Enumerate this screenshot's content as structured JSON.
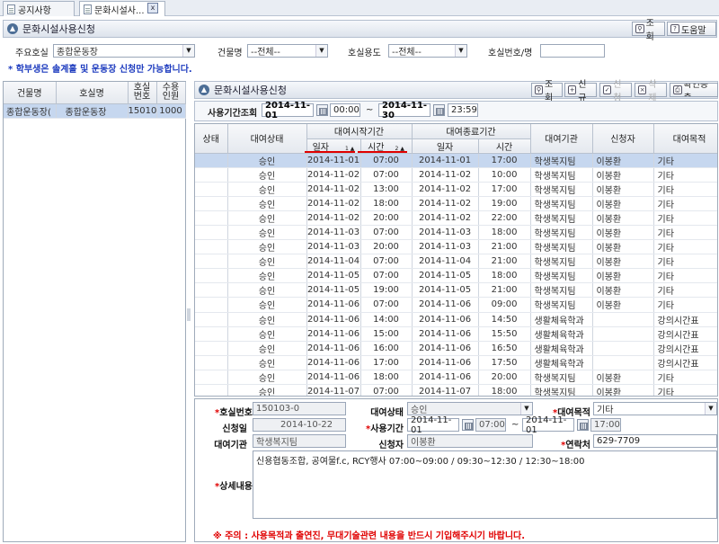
{
  "tabs": [
    {
      "label": "공지사항",
      "active": false
    },
    {
      "label": "문화시설사...",
      "active": true
    }
  ],
  "top_panel": {
    "title": "문화시설사용신청",
    "buttons": {
      "search": "조회",
      "help": "도움말"
    }
  },
  "filters": {
    "main_facility_label": "주요호실",
    "main_facility_value": "종합운동장",
    "building_label": "건물명",
    "building_value": "--전체--",
    "usage_label": "호실용도",
    "usage_value": "--전체--",
    "room_no_label": "호실번호/명",
    "room_no_value": ""
  },
  "notice": "* 학부생은 솔계홀 및 운동장 신청만 가능합니다.",
  "left_grid": {
    "headers": {
      "building": "건물명",
      "room": "호실명",
      "room_no_1": "호실",
      "room_no_2": "번호",
      "capacity_1": "수용",
      "capacity_2": "인원"
    },
    "rows": [
      {
        "building": "종합운동장(",
        "room": "종합운동장",
        "room_no": "150103",
        "capacity": "1000"
      }
    ]
  },
  "right_panel": {
    "title": "문화시설사용신청",
    "buttons": {
      "search": "조회",
      "new": "신규",
      "apply": "신청",
      "delete": "삭제",
      "print": "확인증출"
    }
  },
  "period": {
    "label": "사용기간조회",
    "from_date": "2014-11-01",
    "from_time": "00:00",
    "sep": "~",
    "to_date": "2014-11-30",
    "to_time": "23:59"
  },
  "grid": {
    "headers": {
      "status": "상태",
      "rent_status": "대여상태",
      "start_group": "대여시작기간",
      "start_date": "일자",
      "start_date_sort": "1",
      "start_time": "시간",
      "start_time_sort": "2",
      "end_group": "대여종료기간",
      "end_date": "일자",
      "end_time": "시간",
      "agency": "대여기관",
      "applicant": "신청자",
      "purpose": "대여목적"
    },
    "rows": [
      {
        "rent_status": "승인",
        "start_date": "2014-11-01",
        "start_time": "07:00",
        "end_date": "2014-11-01",
        "end_time": "17:00",
        "agency": "학생복지팀",
        "applicant": "이봉환",
        "purpose": "기타"
      },
      {
        "rent_status": "승인",
        "start_date": "2014-11-02",
        "start_time": "07:00",
        "end_date": "2014-11-02",
        "end_time": "10:00",
        "agency": "학생복지팀",
        "applicant": "이봉환",
        "purpose": "기타"
      },
      {
        "rent_status": "승인",
        "start_date": "2014-11-02",
        "start_time": "13:00",
        "end_date": "2014-11-02",
        "end_time": "17:00",
        "agency": "학생복지팀",
        "applicant": "이봉환",
        "purpose": "기타"
      },
      {
        "rent_status": "승인",
        "start_date": "2014-11-02",
        "start_time": "18:00",
        "end_date": "2014-11-02",
        "end_time": "19:00",
        "agency": "학생복지팀",
        "applicant": "이봉환",
        "purpose": "기타"
      },
      {
        "rent_status": "승인",
        "start_date": "2014-11-02",
        "start_time": "20:00",
        "end_date": "2014-11-02",
        "end_time": "22:00",
        "agency": "학생복지팀",
        "applicant": "이봉환",
        "purpose": "기타"
      },
      {
        "rent_status": "승인",
        "start_date": "2014-11-03",
        "start_time": "07:00",
        "end_date": "2014-11-03",
        "end_time": "18:00",
        "agency": "학생복지팀",
        "applicant": "이봉환",
        "purpose": "기타"
      },
      {
        "rent_status": "승인",
        "start_date": "2014-11-03",
        "start_time": "20:00",
        "end_date": "2014-11-03",
        "end_time": "21:00",
        "agency": "학생복지팀",
        "applicant": "이봉환",
        "purpose": "기타"
      },
      {
        "rent_status": "승인",
        "start_date": "2014-11-04",
        "start_time": "07:00",
        "end_date": "2014-11-04",
        "end_time": "21:00",
        "agency": "학생복지팀",
        "applicant": "이봉환",
        "purpose": "기타"
      },
      {
        "rent_status": "승인",
        "start_date": "2014-11-05",
        "start_time": "07:00",
        "end_date": "2014-11-05",
        "end_time": "18:00",
        "agency": "학생복지팀",
        "applicant": "이봉환",
        "purpose": "기타"
      },
      {
        "rent_status": "승인",
        "start_date": "2014-11-05",
        "start_time": "19:00",
        "end_date": "2014-11-05",
        "end_time": "21:00",
        "agency": "학생복지팀",
        "applicant": "이봉환",
        "purpose": "기타"
      },
      {
        "rent_status": "승인",
        "start_date": "2014-11-06",
        "start_time": "07:00",
        "end_date": "2014-11-06",
        "end_time": "09:00",
        "agency": "학생복지팀",
        "applicant": "이봉환",
        "purpose": "기타"
      },
      {
        "rent_status": "승인",
        "start_date": "2014-11-06",
        "start_time": "14:00",
        "end_date": "2014-11-06",
        "end_time": "14:50",
        "agency": "생활체육학과",
        "applicant": "",
        "purpose": "강의시간표"
      },
      {
        "rent_status": "승인",
        "start_date": "2014-11-06",
        "start_time": "15:00",
        "end_date": "2014-11-06",
        "end_time": "15:50",
        "agency": "생활체육학과",
        "applicant": "",
        "purpose": "강의시간표"
      },
      {
        "rent_status": "승인",
        "start_date": "2014-11-06",
        "start_time": "16:00",
        "end_date": "2014-11-06",
        "end_time": "16:50",
        "agency": "생활체육학과",
        "applicant": "",
        "purpose": "강의시간표"
      },
      {
        "rent_status": "승인",
        "start_date": "2014-11-06",
        "start_time": "17:00",
        "end_date": "2014-11-06",
        "end_time": "17:50",
        "agency": "생활체육학과",
        "applicant": "",
        "purpose": "강의시간표"
      },
      {
        "rent_status": "승인",
        "start_date": "2014-11-06",
        "start_time": "18:00",
        "end_date": "2014-11-06",
        "end_time": "20:00",
        "agency": "학생복지팀",
        "applicant": "이봉환",
        "purpose": "기타"
      },
      {
        "rent_status": "승인",
        "start_date": "2014-11-07",
        "start_time": "07:00",
        "end_date": "2014-11-07",
        "end_time": "18:00",
        "agency": "학생복지팀",
        "applicant": "이봉환",
        "purpose": "기타"
      }
    ]
  },
  "detail": {
    "room_no_label": "호실번호",
    "room_no_value": "150103-0",
    "rent_status_label": "대여상태",
    "rent_status_value": "승인",
    "purpose_label": "대여목적",
    "purpose_value": "기타",
    "apply_date_label": "신청일",
    "apply_date_value": "2014-10-22",
    "period_label": "사용기간",
    "period_from_date": "2014-11-01",
    "period_from_time": "07:00",
    "period_sep": "~",
    "period_to_date": "2014-11-01",
    "period_to_time": "17:00",
    "agency_label": "대여기관",
    "agency_value": "학생복지팀",
    "applicant_label": "신청자",
    "applicant_value": "이봉환",
    "contact_label": "연락처",
    "contact_value": "629-7709",
    "detail_label": "상세내용",
    "detail_value": "신용협동조합, 공여물f.c, RCY행사 07:00~09:00 / 09:30~12:30 / 12:30~18:00",
    "warning": "※ 주의 : 사용목적과 출연진, 무대기술관련 내용을 반드시 기입해주시기 바랍니다."
  },
  "colors": {
    "selected_row": "#c6d7ef",
    "required": "#e00000",
    "notice": "#1d3bbf"
  }
}
